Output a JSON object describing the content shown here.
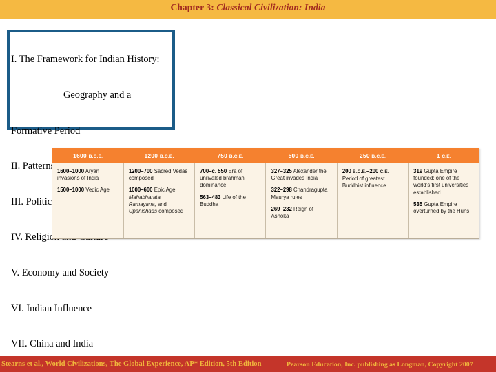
{
  "slide": {
    "title": {
      "prefix": "Chapter 3: ",
      "subject": "Classical Civilization: India"
    }
  },
  "outline": {
    "items": [
      "I. The Framework for Indian History:",
      "Geography and a",
      "Formative Period",
      "II. Patterns in Classical India",
      "III. Political Institutions",
      "IV. Religion and Culture",
      "V. Economy and Society",
      "VI. Indian Influence",
      "VII. China and India"
    ]
  },
  "timeline": {
    "columns": [
      {
        "header_year": "1600",
        "header_era": "B.C.E.",
        "entries": [
          {
            "date": "1600–1000",
            "text": " Aryan invasions of India"
          },
          {
            "date": "1500–1000",
            "text": " Vedic Age"
          }
        ]
      },
      {
        "header_year": "1200",
        "header_era": "B.C.E.",
        "entries": [
          {
            "date": "1200–700",
            "text": " Sacred Vedas composed"
          },
          {
            "date": "1000–600",
            "text": " Epic Age: ",
            "italic": "Mahabharata, Ramayana,",
            "text2": " and ",
            "italic2": "Upanishads",
            "text3": " composed"
          }
        ]
      },
      {
        "header_year": "750",
        "header_era": "B.C.E.",
        "entries": [
          {
            "date": "700–c. 550",
            "text": " Era of unrivaled brahman dominance"
          },
          {
            "date": "563–483",
            "text": " Life of the Buddha"
          }
        ]
      },
      {
        "header_year": "500",
        "header_era": "B.C.E.",
        "entries": [
          {
            "date": "327–325",
            "text": " Alexander the Great invades India"
          },
          {
            "date": "322–298",
            "text": " Chandragupta Maurya rules"
          },
          {
            "date": "269–232",
            "text": " Reign of Ashoka"
          }
        ]
      },
      {
        "header_year": "250",
        "header_era": "B.C.E.",
        "entries": [
          {
            "date": "200",
            "era1": "B.C.E.",
            "dash": "–",
            "date2": "200",
            "era2": "C.E.",
            "text": " Period of greatest Buddhist influence"
          }
        ]
      },
      {
        "header_year": "1",
        "header_era": "C.E.",
        "entries": [
          {
            "date": "319",
            "text": " Gupta Empire founded; one of the world’s first universities established"
          },
          {
            "date": "535",
            "text": " Gupta Empire overturned by the Huns"
          }
        ]
      }
    ]
  },
  "footer": {
    "left": "Stearns et al., World Civilizations, The Global Experience, AP* Edition, 5th Edition",
    "right": "Pearson Education, Inc. publishing as Longman, Copyright 2007"
  },
  "colors": {
    "banner": "#f5b942",
    "title_text": "#a32c20",
    "outline_border": "#1b5c88",
    "table_header": "#f5812f",
    "table_body": "#fbf3e6",
    "footer_bar": "#c4352a",
    "footer_text": "#f0b63c"
  }
}
